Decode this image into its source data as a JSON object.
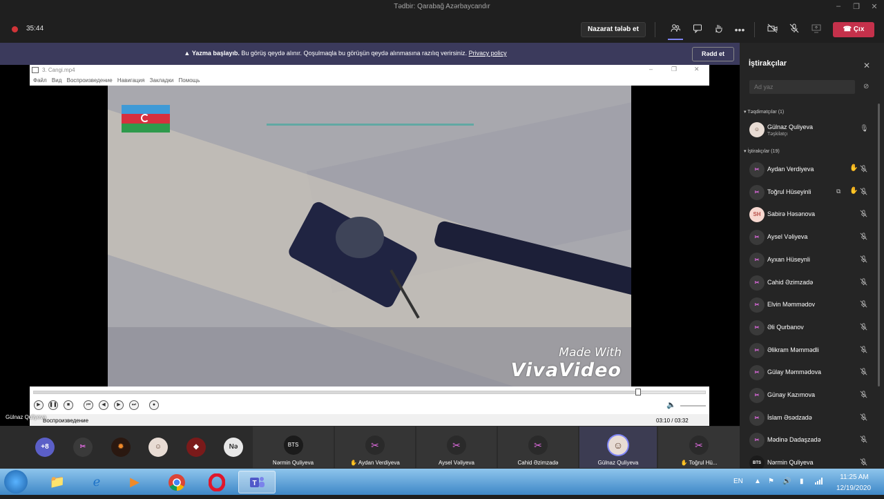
{
  "window": {
    "title": "Tədbir: Qarabağ Azərbaycandır",
    "minimize": "–",
    "maximize": "❐",
    "close": "✕"
  },
  "toolbar": {
    "timer": "35:44",
    "request_control": "Nazarat tələb et",
    "leave": "Çıx"
  },
  "banner": {
    "warning_icon": "▲",
    "bold": "Yazma başlayıb.",
    "message": " Bu görüş qeydə alınır. Qoşulmaqla bu görüşün qeydə alınmasına razılıq verirsiniz. ",
    "link": "Privacy policy",
    "dismiss": "Rədd et"
  },
  "player": {
    "title": "3. Cangi.mp4",
    "menu": [
      "Файл",
      "Вид",
      "Воспроизведение",
      "Навигация",
      "Закладки",
      "Помощь"
    ],
    "watermark_line1": "Made With",
    "watermark_line2": "VivaVideo",
    "status": "Воспроизведение",
    "time": "03:10 / 03:32",
    "progress": 0.9
  },
  "stage_name": "Gülnaz Quliyeva",
  "gallery": {
    "overflow": "+8",
    "round_initials": "Nə",
    "tiles": [
      {
        "name": "Nərmin Quliyeva",
        "initials": "BTS"
      },
      {
        "name": "✋ Aydan Verdiyeva",
        "initials": ""
      },
      {
        "name": "Aysel Vəliyeva",
        "initials": ""
      },
      {
        "name": "Cahid Əzimzadə",
        "initials": ""
      },
      {
        "name": "Gülnaz Quliyeva",
        "initials": ""
      },
      {
        "name": "✋ Toğrul Hü...",
        "initials": ""
      }
    ]
  },
  "panel": {
    "title": "İştirakçılar",
    "invite_placeholder": "Ad yaz",
    "presenters_header": "Təqdimatçılar (1)",
    "attendees_header": "İştirakçılar (19)",
    "organizer": {
      "name": "Gülnaz Quliyeva",
      "role": "Təşkilatçı"
    },
    "attendees": [
      {
        "name": "Aydan Verdiyeva",
        "initials": "",
        "hand": true
      },
      {
        "name": "Toğrul Hüseyinli",
        "initials": "",
        "hand": true,
        "sharing": true
      },
      {
        "name": "Sabirə Həsənova",
        "initials": "SH"
      },
      {
        "name": "Aysel Vəliyeva",
        "initials": ""
      },
      {
        "name": "Ayxan Hüseynli",
        "initials": ""
      },
      {
        "name": "Cahid Əzimzadə",
        "initials": ""
      },
      {
        "name": "Elvin Məmmədov",
        "initials": ""
      },
      {
        "name": "Əli Qurbanov",
        "initials": ""
      },
      {
        "name": "Əlikram Məmmədli",
        "initials": ""
      },
      {
        "name": "Gülay Məmmədova",
        "initials": ""
      },
      {
        "name": "Günay Kazımova",
        "initials": ""
      },
      {
        "name": "İslam Əsədzadə",
        "initials": ""
      },
      {
        "name": "Mədinə Dadaşzadə",
        "initials": ""
      },
      {
        "name": "Nərmin Quliyeva",
        "initials": "BTS"
      }
    ]
  },
  "taskbar": {
    "lang": "EN",
    "time": "11:25 AM",
    "date": "12/19/2020"
  },
  "colors": {
    "accent": "#7f85f5",
    "leave": "#c4314b",
    "banner": "#3b3a5c",
    "raised_hand": "#f2c12e"
  }
}
